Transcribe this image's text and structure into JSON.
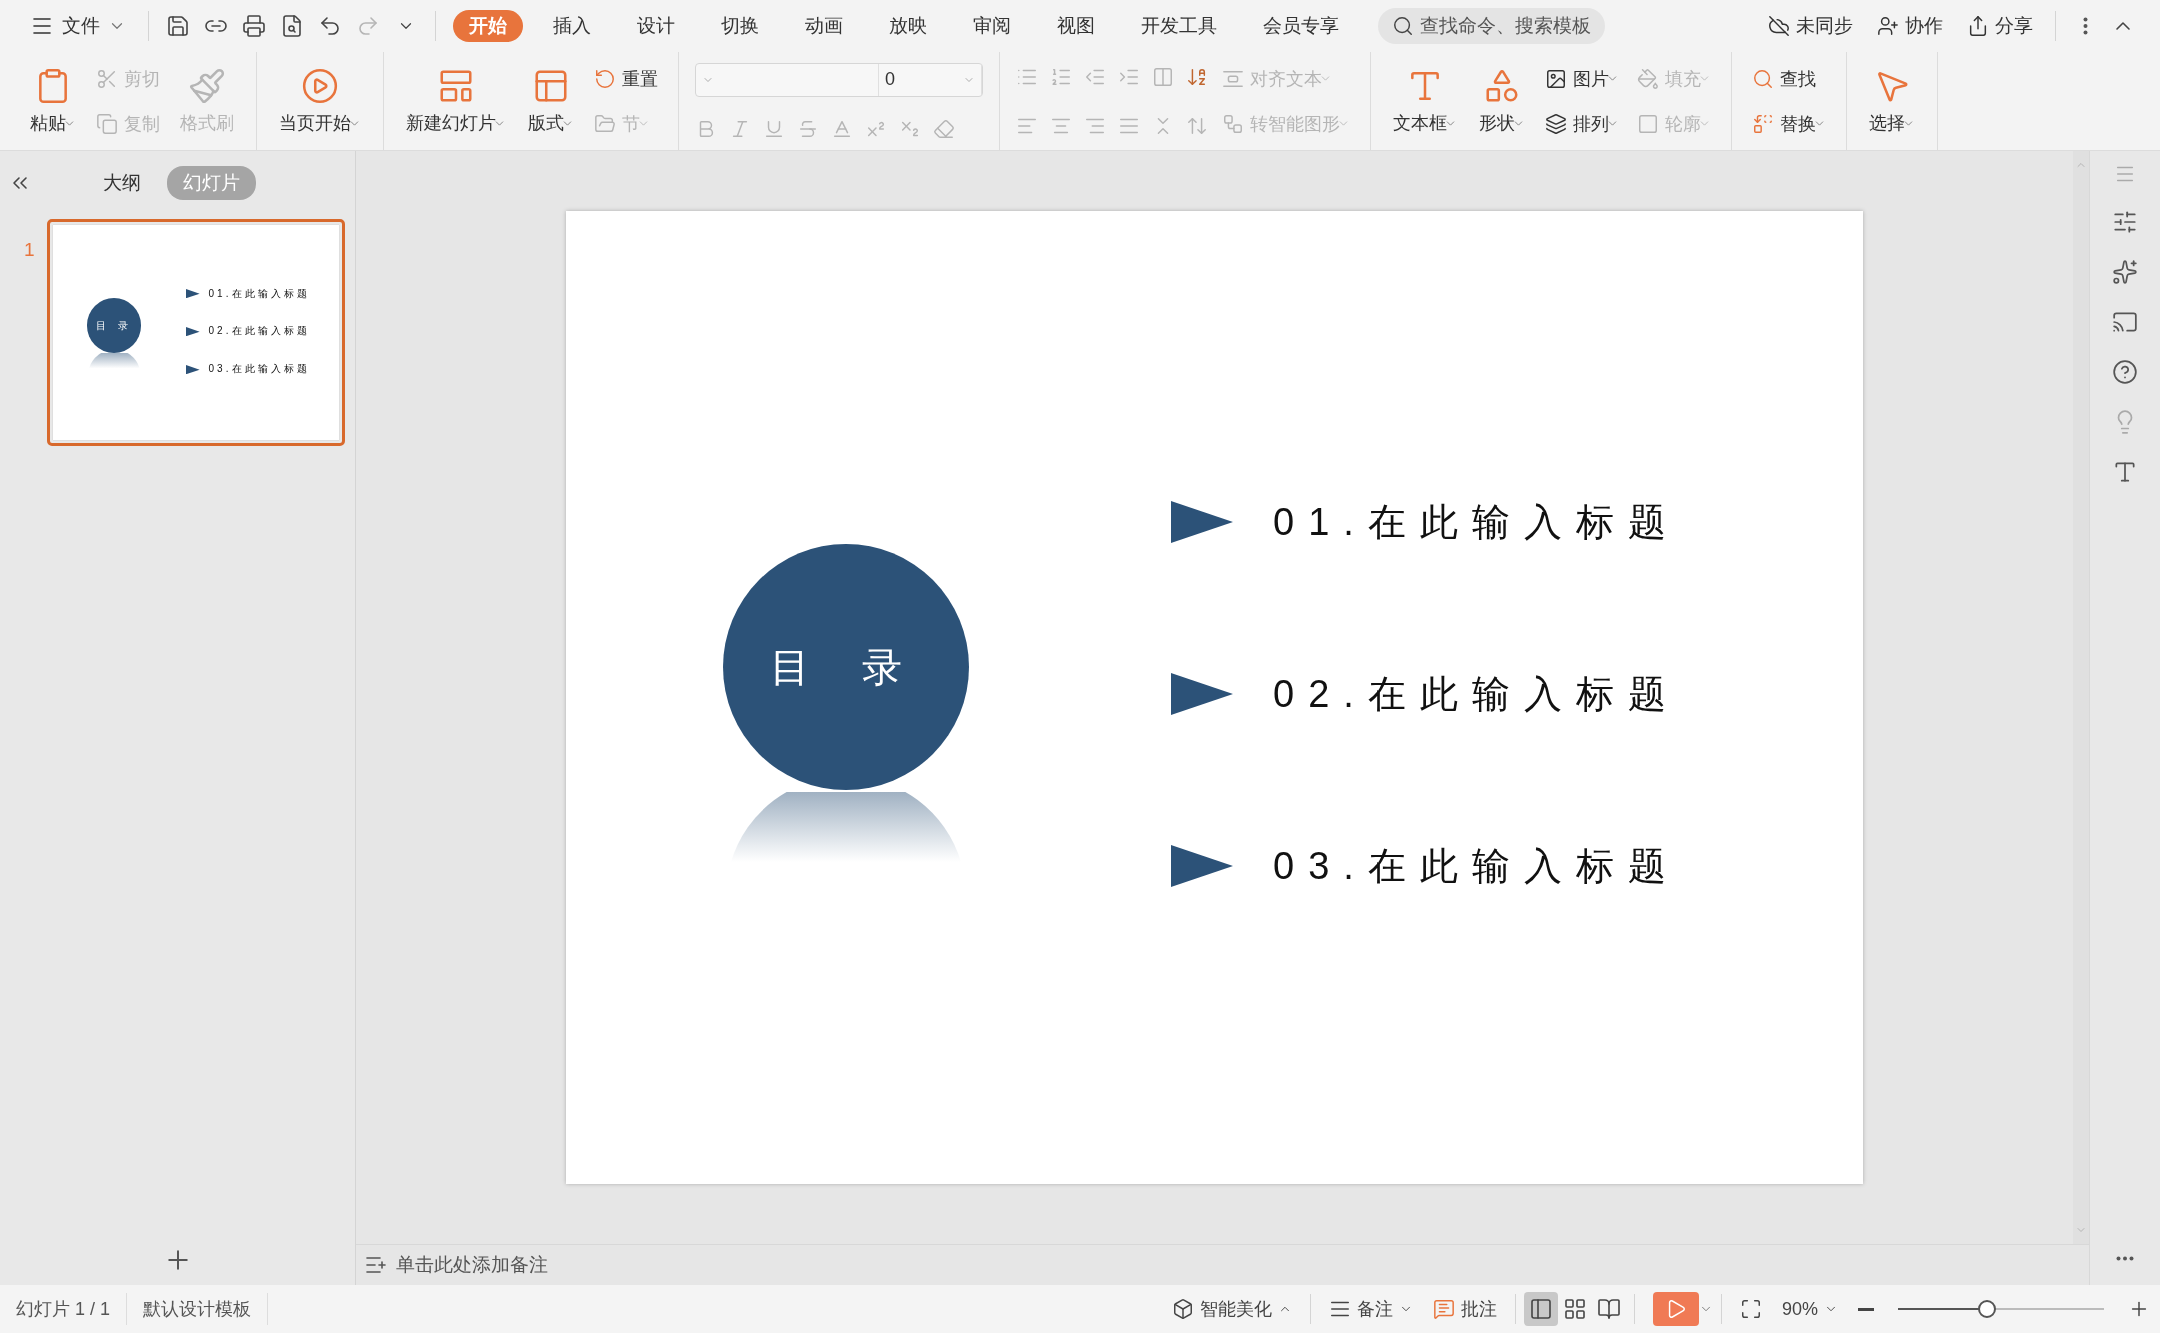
{
  "title_bar": {
    "file_menu": "文件",
    "tabs": [
      {
        "label": "开始",
        "selected": true
      },
      {
        "label": "插入",
        "selected": false
      },
      {
        "label": "设计",
        "selected": false
      },
      {
        "label": "切换",
        "selected": false
      },
      {
        "label": "动画",
        "selected": false
      },
      {
        "label": "放映",
        "selected": false
      },
      {
        "label": "审阅",
        "selected": false
      },
      {
        "label": "视图",
        "selected": false
      },
      {
        "label": "开发工具",
        "selected": false
      },
      {
        "label": "会员专享",
        "selected": false
      }
    ],
    "search": {
      "placeholder": "查找命令、搜索模板"
    },
    "actions": [
      "未同步",
      "协作",
      "分享"
    ]
  },
  "ribbon": {
    "groups": [
      {
        "columns": [
          {
            "kind": "large",
            "label": "粘贴",
            "dropdown": true,
            "disabled": false
          },
          {
            "kind": "stack",
            "items": [
              {
                "label": "剪切",
                "dropdown": false,
                "disabled": true
              },
              {
                "label": "复制",
                "dropdown": false,
                "disabled": true
              }
            ]
          },
          {
            "kind": "large",
            "label": "格式刷",
            "dropdown": false,
            "disabled": true
          }
        ]
      },
      {
        "columns": [
          {
            "kind": "large",
            "label": "当页开始",
            "dropdown": true,
            "disabled": false
          }
        ]
      },
      {
        "columns": [
          {
            "kind": "large",
            "label": "新建幻灯片",
            "dropdown": true,
            "disabled": false
          },
          {
            "kind": "large",
            "label": "版式",
            "dropdown": true,
            "disabled": false
          },
          {
            "kind": "stack",
            "items": [
              {
                "label": "重置",
                "dropdown": false,
                "disabled": false
              },
              {
                "label": "节",
                "dropdown": true,
                "disabled": true
              }
            ]
          }
        ]
      },
      {
        "columns": [
          {
            "kind": "font",
            "size_value": "0"
          }
        ]
      },
      {
        "columns": [
          {
            "kind": "paragraph"
          },
          {
            "kind": "stack",
            "items": [
              {
                "label": "对齐文本",
                "dropdown": true,
                "disabled": true
              },
              {
                "label": "转智能图形",
                "dropdown": true,
                "disabled": true
              }
            ]
          }
        ]
      },
      {
        "columns": [
          {
            "kind": "large",
            "label": "文本框",
            "dropdown": true,
            "disabled": false
          },
          {
            "kind": "large",
            "label": "形状",
            "dropdown": true,
            "disabled": false
          },
          {
            "kind": "stack",
            "items": [
              {
                "label": "图片",
                "dropdown": true,
                "disabled": false
              },
              {
                "label": "排列",
                "dropdown": true,
                "disabled": false
              }
            ]
          },
          {
            "kind": "stack",
            "items": [
              {
                "label": "填充",
                "dropdown": true,
                "disabled": true
              },
              {
                "label": "轮廓",
                "dropdown": true,
                "disabled": true
              }
            ]
          }
        ]
      },
      {
        "columns": [
          {
            "kind": "stack",
            "items": [
              {
                "label": "查找",
                "dropdown": false,
                "disabled": false
              },
              {
                "label": "替换",
                "dropdown": true,
                "disabled": false
              }
            ]
          }
        ]
      },
      {
        "columns": [
          {
            "kind": "large",
            "label": "选择",
            "dropdown": true,
            "disabled": false
          }
        ]
      }
    ]
  },
  "left_panel": {
    "tabs": [
      {
        "label": "大纲",
        "selected": false
      },
      {
        "label": "幻灯片",
        "selected": true
      }
    ],
    "slides": [
      {
        "number": "1",
        "selected": true,
        "title": "目 录",
        "items": [
          "01.在此输入标题",
          "02.在此输入标题",
          "03.在此输入标题"
        ]
      }
    ]
  },
  "slide": {
    "title": "目 录",
    "items": [
      "01.在此输入标题",
      "02.在此输入标题",
      "03.在此输入标题"
    ]
  },
  "notes": {
    "placeholder": "单击此处添加备注"
  },
  "status_bar": {
    "slide_info": "幻灯片 1 / 1",
    "template": "默认设计模板",
    "beautify": "智能美化",
    "notes": "备注",
    "comments": "批注",
    "views": [
      {
        "selected": true
      },
      {
        "selected": false
      },
      {
        "selected": false
      }
    ],
    "zoom": "90%",
    "zoom_slider": {
      "level": 0.43
    }
  }
}
